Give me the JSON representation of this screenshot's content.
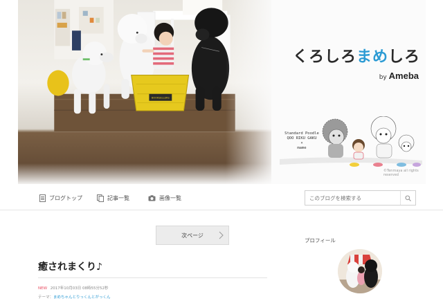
{
  "header": {
    "logo_title_part1": "くろしろ",
    "logo_title_part2": "まめ",
    "logo_title_part3": "しろ",
    "logo_by": "by",
    "logo_brand": "Ameba",
    "illustration_caption_line1": "Standard Poodle",
    "illustration_caption_line2": "QOO RIKU GAKU",
    "illustration_caption_line3": "×",
    "illustration_caption_line4": "mame",
    "copyright": "©Tenmaya all rights reserved",
    "basket_label": "BOOKSELLERS"
  },
  "nav": {
    "items": [
      {
        "label": "ブログトップ",
        "icon": "document-icon"
      },
      {
        "label": "記事一覧",
        "icon": "copy-icon"
      },
      {
        "label": "画像一覧",
        "icon": "camera-icon"
      }
    ],
    "search_placeholder": "このブログを検索する"
  },
  "pager": {
    "next_label": "次ページ"
  },
  "entry": {
    "title": "癒されまくり♪",
    "new_badge": "NEW",
    "date": "2017年10月03日 08時55分52秒",
    "theme_prefix": "テーマ：",
    "theme": "まめちゃんとりっくんとがっくん"
  },
  "sidebar": {
    "profile_heading": "プロフィール"
  },
  "colors": {
    "accent": "#2c9bd4",
    "new_badge": "#e84a5f",
    "basket": "#e6c91e"
  }
}
